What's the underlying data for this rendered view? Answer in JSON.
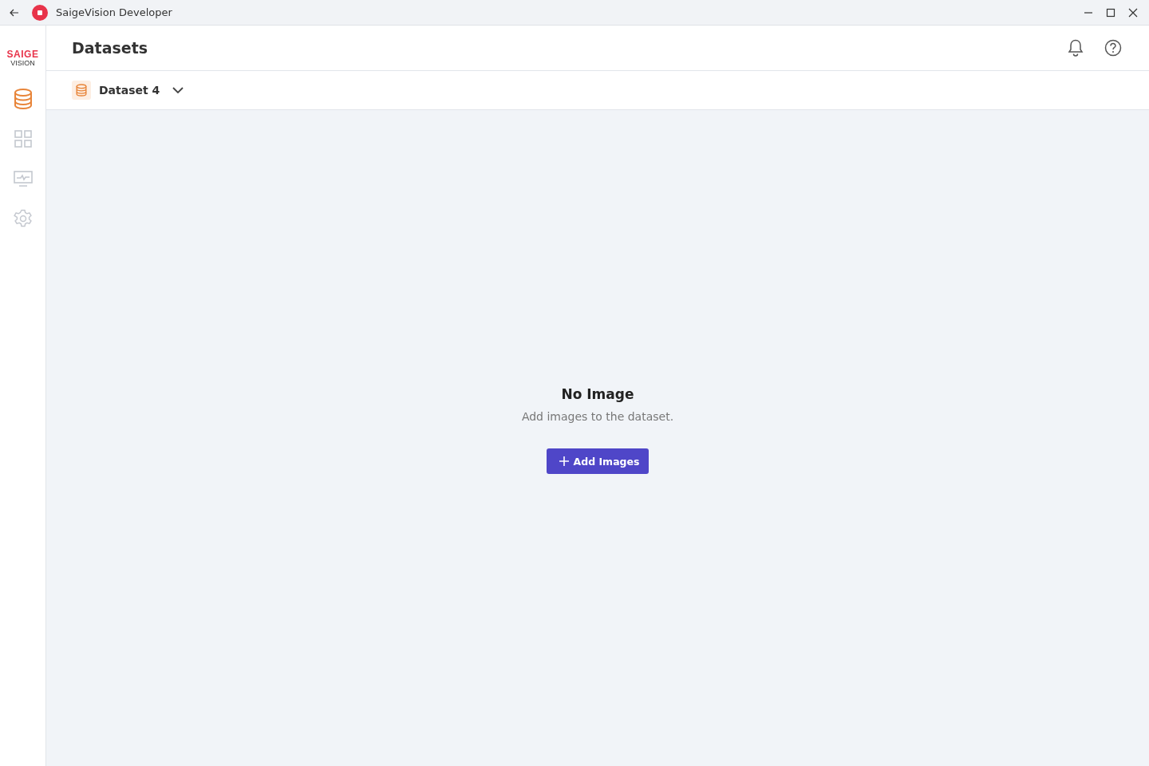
{
  "window": {
    "title": "SaigeVision Developer"
  },
  "logo": {
    "line_1": "SAIGE",
    "line_2": "VISION"
  },
  "sidebar": {
    "items": [
      {
        "kind": "datasets",
        "selected": true
      },
      {
        "kind": "grid",
        "selected": false
      },
      {
        "kind": "monitor",
        "selected": false
      },
      {
        "kind": "settings",
        "selected": false
      }
    ]
  },
  "header": {
    "title": "Datasets"
  },
  "dataset_selector": {
    "label": "Dataset 4"
  },
  "empty_state": {
    "title": "No Image",
    "message": "Add images to the dataset.",
    "button": "Add Images"
  }
}
